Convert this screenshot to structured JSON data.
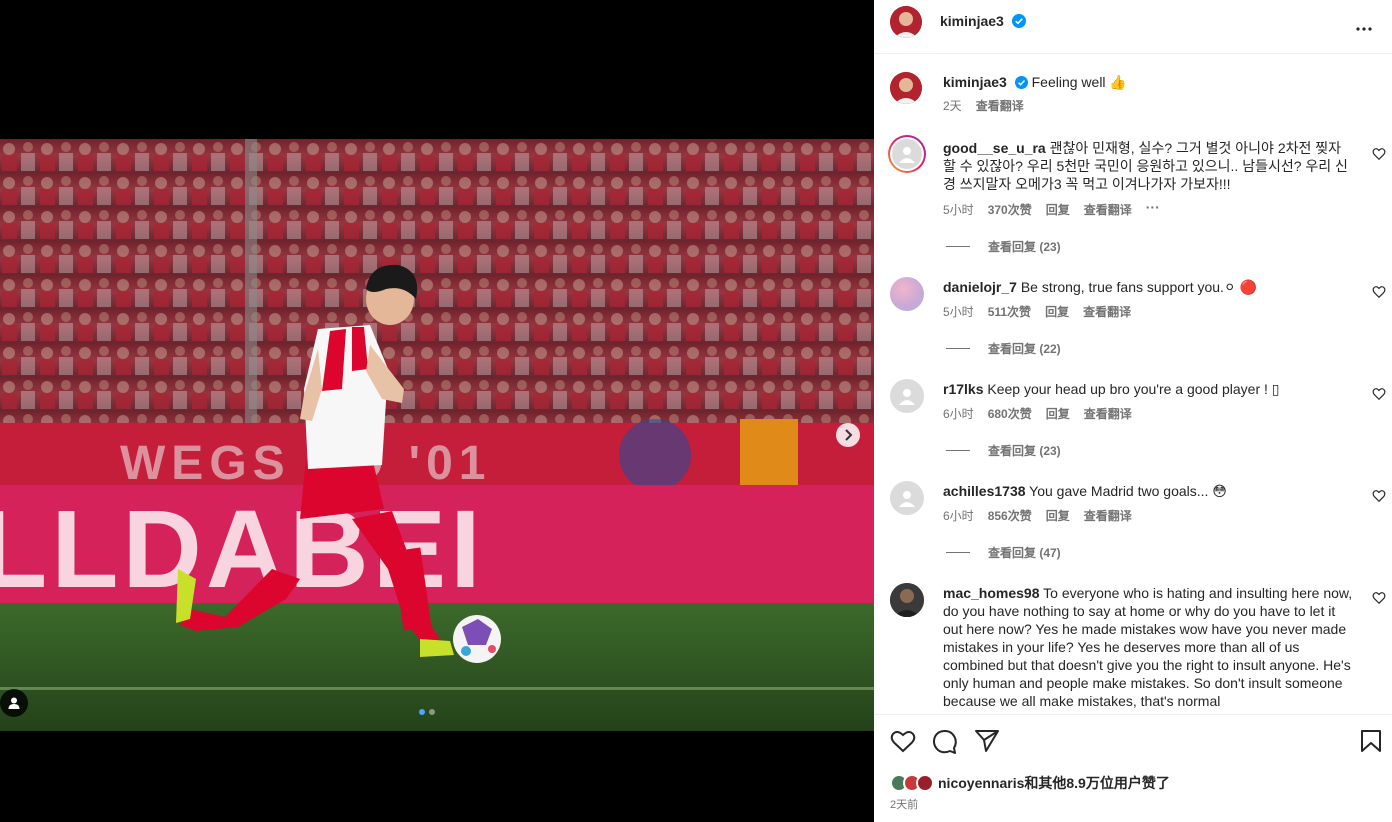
{
  "post": {
    "author": "kiminjae3",
    "caption": "Feeling well 👍",
    "caption_time": "2天",
    "caption_translate": "查看翻译"
  },
  "comments": [
    {
      "user": "good__se_u_ra",
      "text": "괜찮아 민재형, 실수? 그거 별것 아니야 2차전 찢자 할 수 있잖아? 우리 5천만 국민이 응원하고 있으니.. 남들시선? 우리 신경 쓰지말자 오메가3 꼭 먹고 이겨나가자 가보자!!!",
      "time": "5小时",
      "likes": "370次赞",
      "reply": "回复",
      "translate": "查看翻译",
      "more": "···",
      "view_replies": "查看回复 (23)"
    },
    {
      "user": "danielojr_7",
      "text": "Be strong, true fans support you.⚪ 🔴",
      "time": "5小时",
      "likes": "511次赞",
      "reply": "回复",
      "translate": "查看翻译",
      "view_replies": "查看回复 (22)"
    },
    {
      "user": "r17lks",
      "text": "Keep your head up bro you're a good player ! ▯",
      "time": "6小时",
      "likes": "680次赞",
      "reply": "回复",
      "translate": "查看翻译",
      "view_replies": "查看回复 (23)"
    },
    {
      "user": "achilles1738",
      "text": "You gave Madrid two goals... 😳",
      "time": "6小时",
      "likes": "856次赞",
      "reply": "回复",
      "translate": "查看翻译",
      "view_replies": "查看回复 (47)"
    },
    {
      "user": "mac_homes98",
      "text": "To everyone who is hating and insulting here now, do you have nothing to say at home or why do you have to let it out here now? Yes he made mistakes wow have you never made mistakes in your life? Yes he deserves more than all of us combined but that doesn't give you the right to insult anyone. He's only human and people make mistakes. So don't insult someone because we all make mistakes, that's normal"
    }
  ],
  "footer": {
    "liked_by": "nicoyennaris和其他8.9万位用户赞了",
    "date": "2天前"
  },
  "photo": {
    "banner_top": "WEGS  IID  '01",
    "banner_bottom": "LLDABEI"
  },
  "colors": {
    "link": "#00376b",
    "verified": "#0095f6",
    "bayern_red": "#dc052d",
    "banner_pink": "#d6225a"
  },
  "carousel": {
    "current": 1,
    "total": 2
  }
}
